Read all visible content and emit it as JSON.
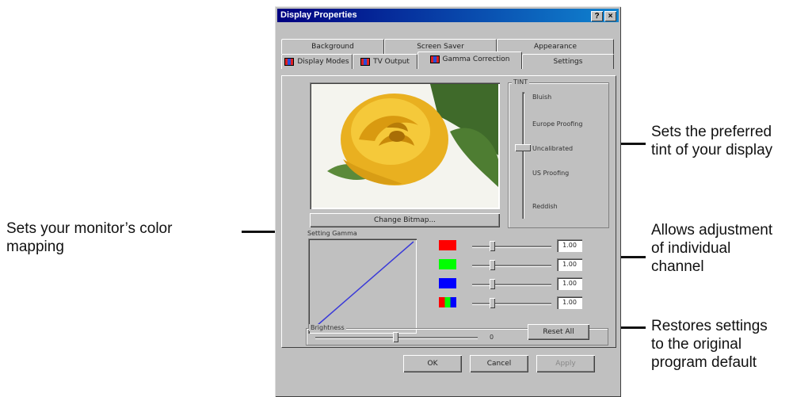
{
  "callouts": {
    "tint": "Sets the preferred\ntint of your display",
    "color_mapping": "Sets your monitor’s color\nmapping",
    "channel": "Allows adjustment\nof individual\nchannel",
    "reset": "Restores settings\nto the original\nprogram default"
  },
  "dialog": {
    "title": "Display Properties",
    "help_glyph": "?",
    "close_glyph": "×",
    "tabs_row1": [
      "Background",
      "Screen Saver",
      "Appearance"
    ],
    "tabs_row2": [
      "Display Modes",
      "TV Output",
      "Gamma Correction",
      "Settings"
    ],
    "active_tab": "Gamma Correction",
    "tint": {
      "label": "TINT",
      "options": [
        "Bluish",
        "Europe Proofing",
        "Uncalibrated",
        "US Proofing",
        "Reddish"
      ],
      "selected": "Uncalibrated"
    },
    "change_bitmap_label": "Change Bitmap...",
    "gamma": {
      "label": "Setting Gamma",
      "channels": [
        {
          "name": "red",
          "color": "#ff0000",
          "value": "1.00",
          "level": 0.3
        },
        {
          "name": "green",
          "color": "#00ff00",
          "value": "1.00",
          "level": 0.3
        },
        {
          "name": "blue",
          "color": "#0000ff",
          "value": "1.00",
          "level": 0.3
        },
        {
          "name": "all",
          "color": "multicolor",
          "value": "1.00",
          "level": 0.3
        }
      ]
    },
    "brightness": {
      "label": "Brightness",
      "value": "0",
      "level": 0.5
    },
    "reset_all_label": "Reset All",
    "buttons": {
      "ok": "OK",
      "cancel": "Cancel",
      "apply": "Apply"
    }
  }
}
